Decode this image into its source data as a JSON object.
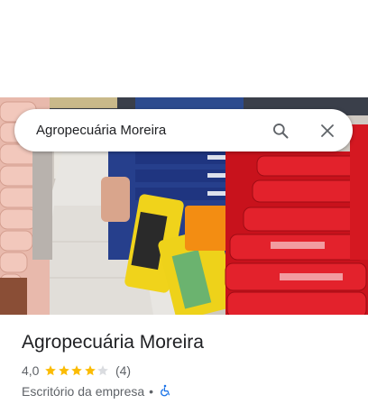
{
  "search": {
    "query": "Agropecuária Moreira"
  },
  "place": {
    "name": "Agropecuária Moreira",
    "rating_text": "4,0",
    "rating_value": 4.0,
    "review_count_text": "(4)",
    "category": "Escritório da empresa",
    "separator": "•"
  },
  "icons": {
    "search": "search-icon",
    "close": "close-icon",
    "accessibility": "wheelchair-icon",
    "star": "star-icon"
  },
  "colors": {
    "star": "#fbbc04",
    "star_empty": "#dadce0",
    "accessible": "#1a73e8",
    "text": "#202124",
    "secondary": "#5f6368"
  }
}
